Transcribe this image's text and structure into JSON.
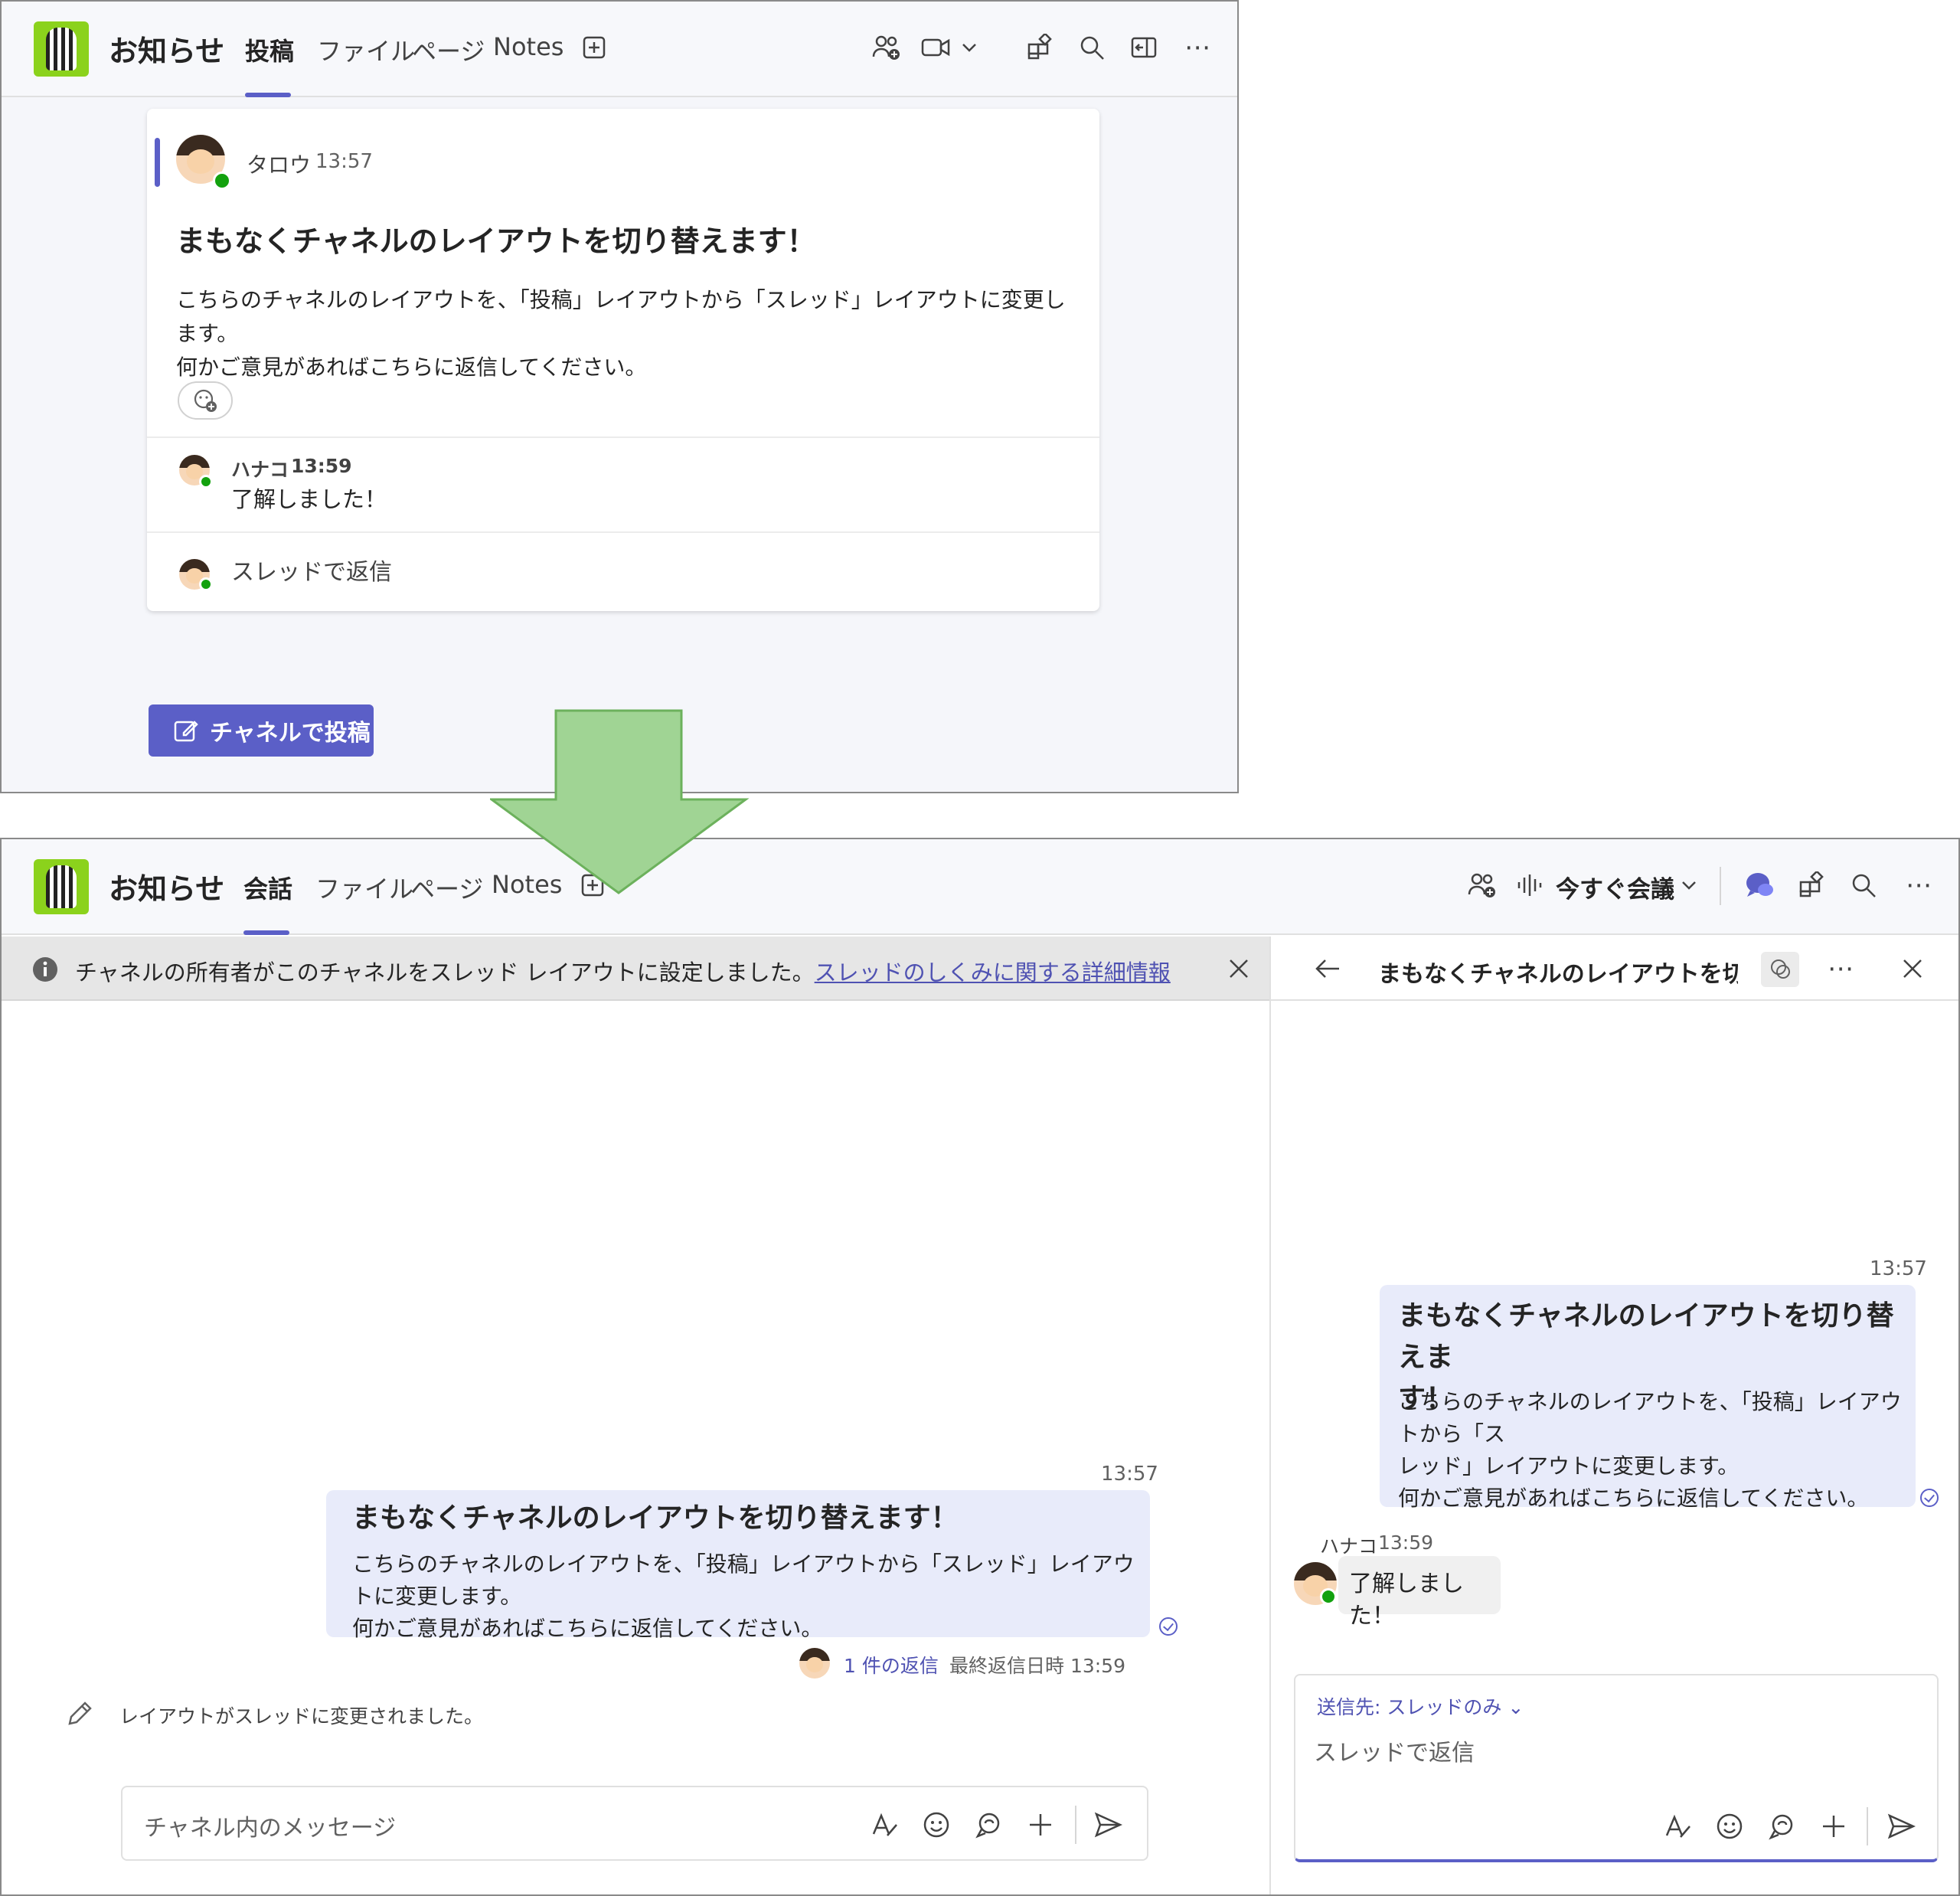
{
  "colors": {
    "accent": "#5b5fc7",
    "presence": "#13a10e",
    "arrow": "#a0d494",
    "bubble": "#e8ebfa"
  },
  "old_view": {
    "channel_title": "お知らせ",
    "tabs": [
      "投稿",
      "ファイル",
      "ページ",
      "Notes"
    ],
    "header_icons": [
      "people-add-icon",
      "video-icon",
      "chevron-down-icon",
      "apps-icon",
      "search-icon",
      "panel-icon",
      "more-icon"
    ],
    "post": {
      "author": "タロウ",
      "time": "13:57",
      "subject": "まもなくチャネルのレイアウトを切り替えます！",
      "body": "こちらのチャネルのレイアウトを、「投稿」レイアウトから「スレッド」レイアウトに変更します。\n何かご意見があればこちらに返信してください。",
      "reply_author": "ハナコ",
      "reply_time": "13:59",
      "reply_text": "了解しました！",
      "reply_prompt": "スレッドで返信"
    },
    "new_post_label": "チャネルで投稿"
  },
  "new_view": {
    "channel_title": "お知らせ",
    "tabs": [
      "会話",
      "ファイル",
      "ページ",
      "Notes"
    ],
    "meet_now": "今すぐ会議",
    "banner_text": "チャネルの所有者がこのチャネルをスレッド レイアウトに設定しました。",
    "banner_link": "スレッドのしくみに関する詳細情報",
    "message": {
      "time": "13:57",
      "subject": "まもなくチャネルのレイアウトを切り替えます！",
      "body": "こちらのチャネルのレイアウトを、「投稿」レイアウトから「スレッド」レイアウトに変更します。\n何かご意見があればこちらに返信してください。",
      "reply_count": "1 件の返信",
      "last_reply": "最終返信日時 13:59"
    },
    "system_notice": "レイアウトがスレッドに変更されました。",
    "compose_placeholder": "チャネル内のメッセージ",
    "thread": {
      "title": "まもなくチャネルのレイアウトを切り替えます！",
      "time": "13:57",
      "subject": "まもなくチャネルのレイアウトを切り替えま\nす！",
      "body": "こちらのチャネルのレイアウトを、「投稿」レイアウトから「ス\nレッド」レイアウトに変更します。\n何かご意見があればこちらに返信してください。",
      "reply_author": "ハナコ",
      "reply_time": "13:59",
      "reply_text": "了解しました！",
      "send_to": "送信先: スレッドのみ",
      "reply_placeholder": "スレッドで返信"
    }
  }
}
